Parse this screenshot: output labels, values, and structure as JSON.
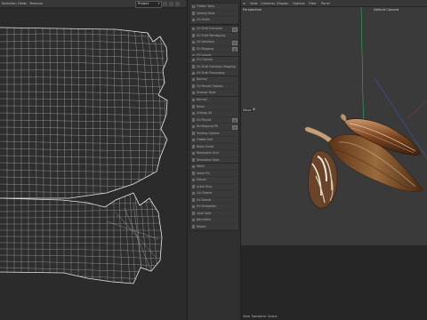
{
  "uv_editor": {
    "menu": [
      "Selection",
      "Fields",
      "Textures"
    ],
    "projection": "Project"
  },
  "tool_panel": {
    "groups": [
      {
        "items": [
          "Flatten Tools",
          "Sewing Tools",
          "UV Shells"
        ]
      },
      {
        "items": [
          "UV Shell Extractor",
          "UV Shell Remapping",
          "UV Selection",
          "UV Mapping",
          "UV Layout"
        ]
      },
      {
        "items": [
          "UV Checker",
          "UV Shell Extractor Mapping",
          "UV Shell Processing"
        ]
      },
      {
        "items": [
          "Normal",
          "UV Pinned Options",
          "Unwrap Tools"
        ]
      },
      {
        "items": [
          "Normal",
          "Relax",
          "Unwrap All",
          "UV Pinned",
          "Re-Mapping Fill",
          "Packing Options",
          "Flatten Edit",
          "Relax Shells",
          "Relaxation Grid",
          "Relaxation Tools"
        ]
      },
      {
        "items": [
          "Stitch",
          "Seam Pin",
          "Detach",
          "Quick Ring",
          "Cut Seams",
          "UV Seams",
          "UV Straighten",
          "Local Split",
          "Normalize",
          "Rotate"
        ]
      }
    ]
  },
  "viewport": {
    "menu": [
      "View",
      "Cameras",
      "Display",
      "Options",
      "Filter",
      "Panel"
    ],
    "perspective_label": "Perspective",
    "camera_label": "Default Camera",
    "move_label": "Move",
    "status": "View Transform: Scene"
  }
}
